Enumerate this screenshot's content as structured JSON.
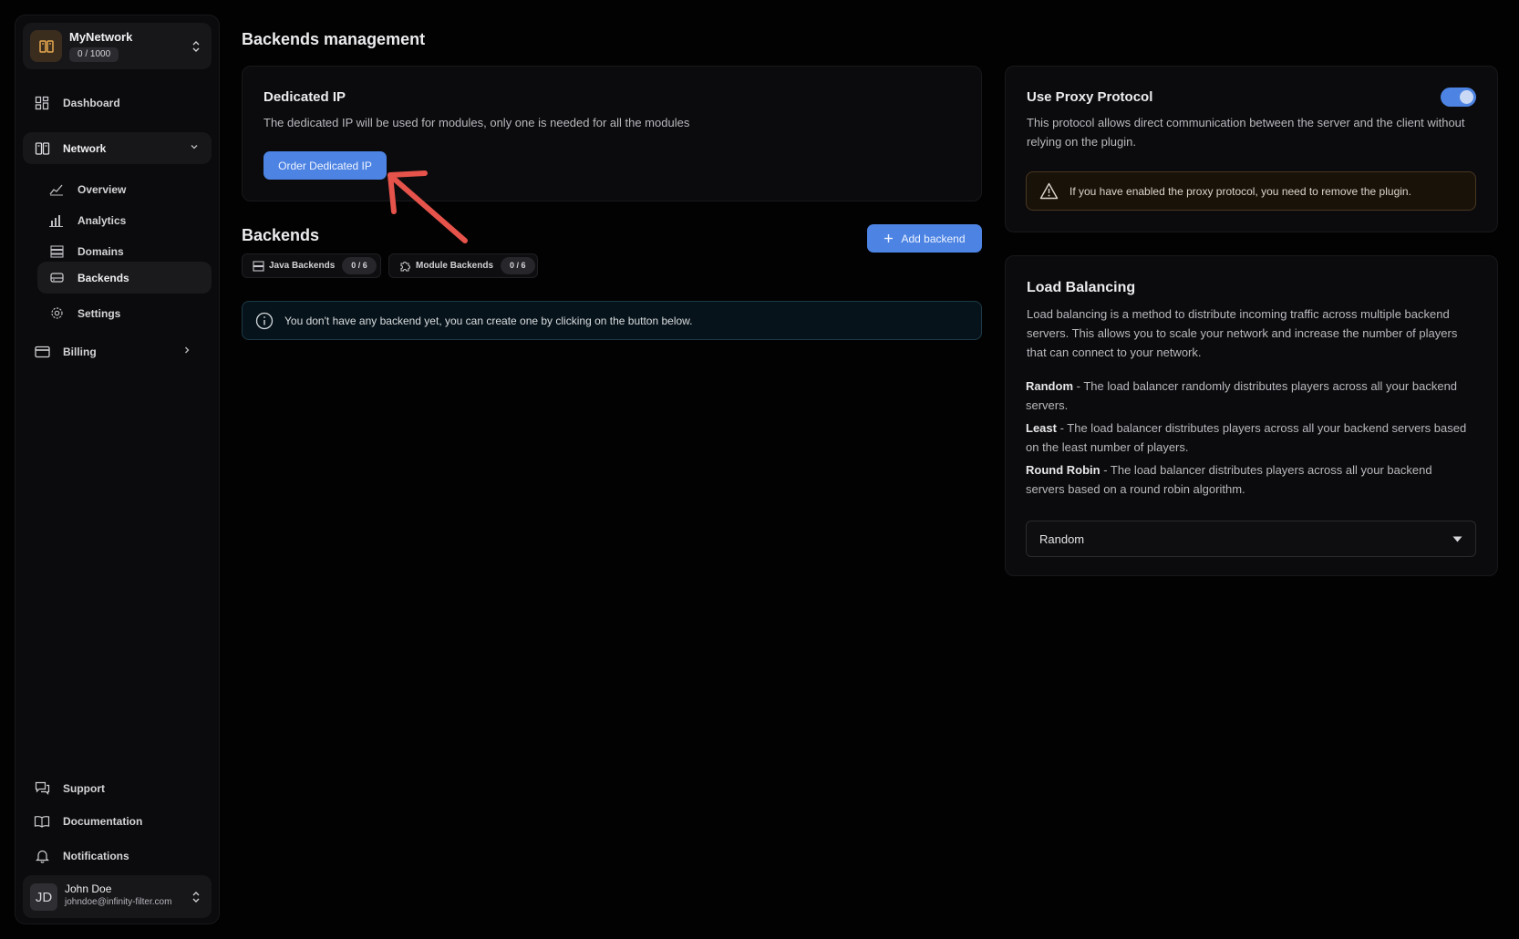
{
  "sidebar": {
    "network_card": {
      "name": "MyNetwork",
      "count": "0 / 1000"
    },
    "nav": {
      "dashboard": "Dashboard",
      "network": "Network",
      "overview": "Overview",
      "analytics": "Analytics",
      "domains": "Domains",
      "backends": "Backends",
      "settings": "Settings",
      "billing": "Billing",
      "support": "Support",
      "documentation": "Documentation",
      "notifications": "Notifications"
    },
    "user": {
      "initials": "JD",
      "name": "John Doe",
      "email": "johndoe@infinity-filter.com"
    }
  },
  "main": {
    "title": "Backends management",
    "dedicated_ip": {
      "title": "Dedicated IP",
      "description": "The dedicated IP will be used for modules, only one is needed for all the modules",
      "button": "Order Dedicated IP"
    },
    "backends": {
      "title": "Backends",
      "add_button": "Add backend",
      "tags": [
        {
          "label": "Java Backends",
          "count": "0 / 6"
        },
        {
          "label": "Module Backends",
          "count": "0 / 6"
        }
      ],
      "empty_message": "You don't have any backend yet, you can create one by clicking on the button below."
    },
    "proxy_protocol": {
      "title": "Use Proxy Protocol",
      "enabled": true,
      "description": "This protocol allows direct communication between the server and the client without relying on the plugin.",
      "warning": "If you have enabled the proxy protocol, you need to remove the plugin."
    },
    "load_balancing": {
      "title": "Load Balancing",
      "description": "Load balancing is a method to distribute incoming traffic across multiple backend servers. This allows you to scale your network and increase the number of players that can connect to your network.",
      "options": [
        {
          "name": "Random",
          "text": " - The load balancer randomly distributes players across all your backend servers."
        },
        {
          "name": "Least",
          "text": " - The load balancer distributes players across all your backend servers based on the least number of players."
        },
        {
          "name": "Round Robin",
          "text": " - The load balancer distributes players across all your backend servers based on a round robin algorithm."
        }
      ],
      "selected": "Random"
    }
  },
  "colors": {
    "accent": "#4d84e3",
    "annotation_arrow": "#e5534b",
    "background": "#020202",
    "card": "#0b0b0d"
  }
}
